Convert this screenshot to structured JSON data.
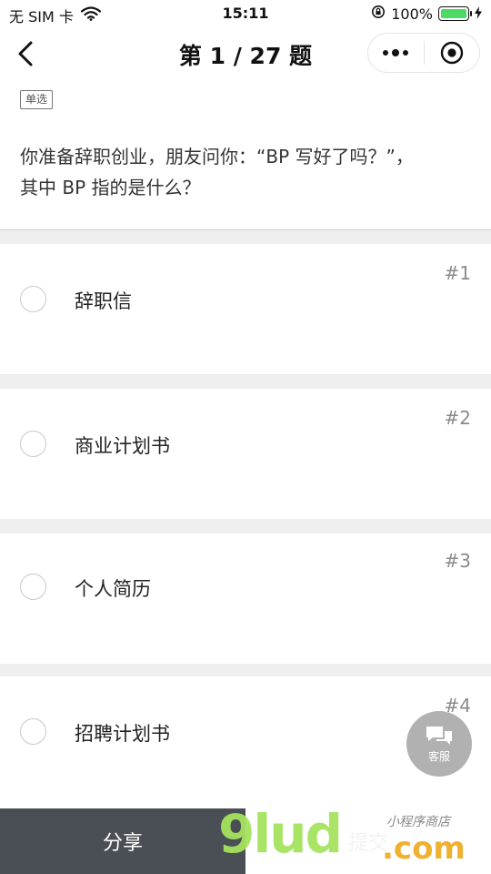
{
  "status_bar": {
    "carrier": "无 SIM 卡",
    "time": "15:11",
    "battery": "100%"
  },
  "nav": {
    "title": "第 1 / 27 题"
  },
  "question": {
    "type_tag": "单选",
    "text": "你准备辞职创业，朋友问你：“BP 写好了吗？”，其中 BP 指的是什么？"
  },
  "options": [
    {
      "label": "辞职信",
      "num": "#1"
    },
    {
      "label": "商业计划书",
      "num": "#2"
    },
    {
      "label": "个人简历",
      "num": "#3"
    },
    {
      "label": "招聘计划书",
      "num": "#4"
    }
  ],
  "service": {
    "label": "客服"
  },
  "bottom": {
    "share_label": "分享",
    "submit_label": "提交"
  },
  "watermark": {
    "logo_left": "9lud",
    "logo_right": ".com",
    "sub": "小程序商店"
  },
  "colors": {
    "battery_green": "#4cd964",
    "share_bg": "#4a4f55",
    "gap_bg": "#efefef"
  }
}
